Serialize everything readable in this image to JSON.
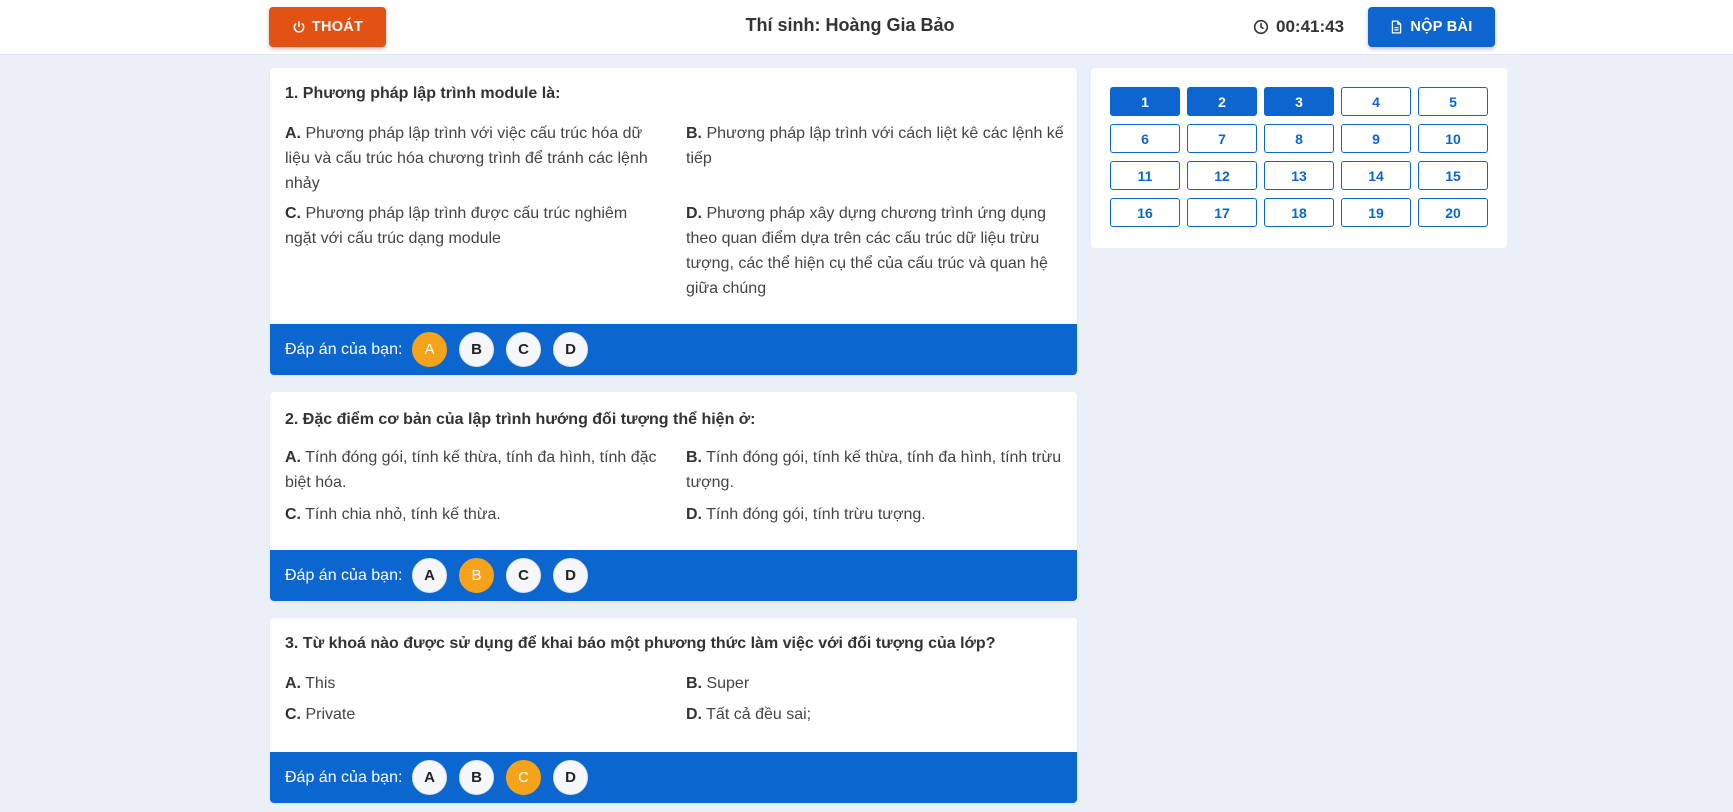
{
  "header": {
    "exit_label": "THOÁT",
    "candidate": "Thí sinh: Hoàng Gia Bảo",
    "timer": "00:41:43",
    "submit_label": "NỘP BÀI"
  },
  "answer_label": "Đáp án của bạn:",
  "choices": [
    "A",
    "B",
    "C",
    "D"
  ],
  "questions": [
    {
      "title": "1. Phương pháp lập trình module là:",
      "options": [
        {
          "key": "A.",
          "text": "Phương pháp lập trình với việc cấu trúc hóa dữ liệu và cấu trúc hóa chương trình để tránh các lệnh nhảy"
        },
        {
          "key": "B.",
          "text": "Phương pháp lập trình với cách liệt kê các lệnh kế tiếp"
        },
        {
          "key": "C.",
          "text": "Phương pháp lập trình được cấu trúc nghiêm ngặt với cấu trúc dạng module"
        },
        {
          "key": "D.",
          "text": "Phương pháp xây dựng chương trình ứng dụng theo quan điểm dựa trên các cấu trúc dữ liệu trừu tượng, các thể hiện cụ thể của cấu trúc và quan hệ giữa chúng"
        }
      ],
      "selected": "A"
    },
    {
      "title": "2. Đặc điểm cơ bản của lập trình hướng đối tượng thể hiện ở:",
      "options": [
        {
          "key": "A.",
          "text": "Tính đóng gói, tính kế thừa, tính đa hình, tính đặc biệt hóa."
        },
        {
          "key": "B.",
          "text": "Tính đóng gói, tính kế thừa, tính đa hình, tính trừu tượng."
        },
        {
          "key": "C.",
          "text": "Tính chia nhỏ, tính kế thừa."
        },
        {
          "key": "D.",
          "text": "Tính đóng gói, tính trừu tượng."
        }
      ],
      "selected": "B"
    },
    {
      "title": "3. Từ khoá nào được sử dụng để khai báo một phương thức làm việc với đối tượng của lớp?",
      "options": [
        {
          "key": "A.",
          "text": "This"
        },
        {
          "key": "B.",
          "text": "Super"
        },
        {
          "key": "C.",
          "text": "Private"
        },
        {
          "key": "D.",
          "text": "Tất cả đều sai;"
        }
      ],
      "selected": "C"
    }
  ],
  "navigator": {
    "labels": [
      "1",
      "2",
      "3",
      "4",
      "5",
      "6",
      "7",
      "8",
      "9",
      "10",
      "11",
      "12",
      "13",
      "14",
      "15",
      "16",
      "17",
      "18",
      "19",
      "20"
    ],
    "answered": [
      "1",
      "2",
      "3"
    ]
  },
  "colors": {
    "accent": "#0d66d0",
    "exit": "#e35213",
    "selected_answer": "#f5a31a",
    "background": "#ebeff7"
  }
}
